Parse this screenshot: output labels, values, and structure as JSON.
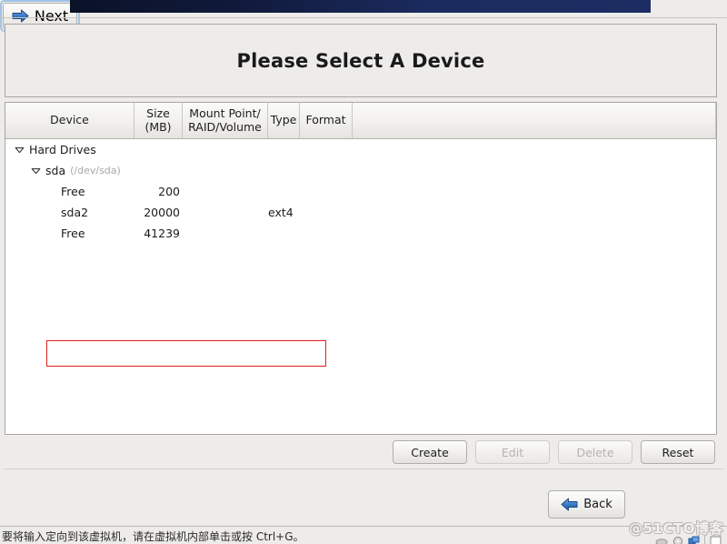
{
  "banner": {
    "name": "installer-banner"
  },
  "title": {
    "text": "Please Select A Device"
  },
  "table": {
    "columns": [
      {
        "key": "device",
        "label": "Device"
      },
      {
        "key": "size",
        "label": "Size\n(MB)",
        "line1": "Size",
        "line2": "(MB)"
      },
      {
        "key": "mount",
        "label": "Mount Point/\nRAID/Volume",
        "line1": "Mount Point/",
        "line2": "RAID/Volume"
      },
      {
        "key": "type",
        "label": "Type"
      },
      {
        "key": "format",
        "label": "Format"
      }
    ],
    "rows": [
      {
        "id": "hard-drives",
        "level": 1,
        "expander": "chevron-down-icon",
        "expanded": true,
        "device": "Hard Drives",
        "path": "",
        "size": "",
        "mount": "",
        "type": "",
        "format": "",
        "highlighted": false
      },
      {
        "id": "sda",
        "level": 2,
        "expander": "chevron-down-icon",
        "expanded": true,
        "device": "sda",
        "path": "(/dev/sda)",
        "size": "",
        "mount": "",
        "type": "",
        "format": "",
        "highlighted": false
      },
      {
        "id": "free-200",
        "level": 3,
        "expander": "",
        "expanded": false,
        "device": "Free",
        "path": "",
        "size": "200",
        "mount": "",
        "type": "",
        "format": "",
        "highlighted": false
      },
      {
        "id": "sda2",
        "level": 3,
        "expander": "",
        "expanded": false,
        "device": "sda2",
        "path": "",
        "size": "20000",
        "mount": "",
        "type": "ext4",
        "format": "",
        "highlighted": true
      },
      {
        "id": "free-41239",
        "level": 3,
        "expander": "",
        "expanded": false,
        "device": "Free",
        "path": "",
        "size": "41239",
        "mount": "",
        "type": "",
        "format": "",
        "highlighted": false
      }
    ]
  },
  "actions": {
    "create": {
      "label": "Create",
      "enabled": true
    },
    "edit": {
      "label": "Edit",
      "enabled": false
    },
    "delete": {
      "label": "Delete",
      "enabled": false
    },
    "reset": {
      "label": "Reset",
      "enabled": true
    }
  },
  "nav": {
    "back": {
      "label": "Back",
      "icon": "arrow-left-icon"
    },
    "next": {
      "label": "Next",
      "icon": "arrow-right-icon",
      "focused": true
    }
  },
  "status": {
    "text": "要将输入定向到该虚拟机，请在虚拟机内部单击或按 Ctrl+G。"
  },
  "watermark": {
    "text": "@51CTO博客"
  },
  "colors": {
    "banner_dark": "#0a1228",
    "banner_blue": "#1d2d63",
    "highlight_red": "#e02020",
    "focus_blue": "#9fc4e8",
    "arrow_blue": "#2f6dbd",
    "panel_bg": "#edecea",
    "table_bg": "#ffffff",
    "muted_text": "#a9a7a4"
  }
}
